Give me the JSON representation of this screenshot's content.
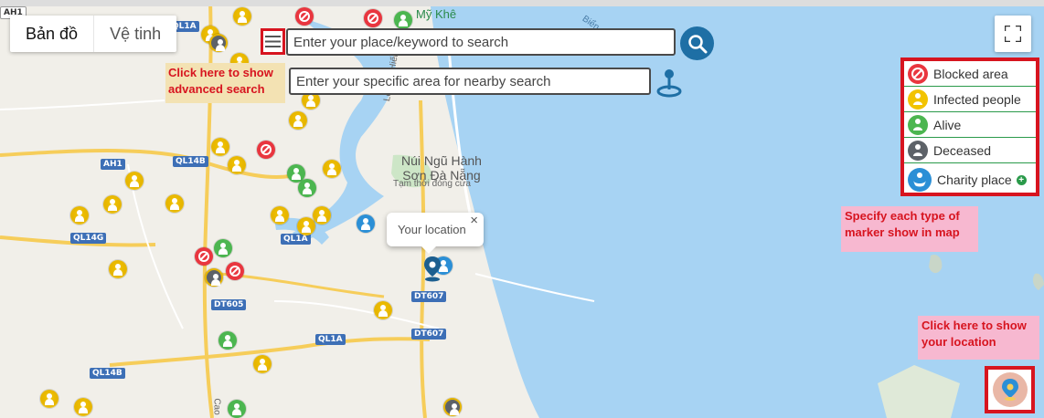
{
  "map_type": {
    "map_label": "Bản đồ",
    "satellite_label": "Vệ tinh"
  },
  "search": {
    "main_placeholder": "Enter your place/keyword to search",
    "nearby_placeholder": "Enter your specific area for nearby search"
  },
  "notes": {
    "advanced": "Click here to show advanced search",
    "legend": "Specify each type of marker show in map",
    "location": "Click here to show your location"
  },
  "legend": {
    "items": [
      {
        "label": "Blocked area",
        "icon": "blocked-icon"
      },
      {
        "label": "Infected people",
        "icon": "infected-person-icon"
      },
      {
        "label": "Alive",
        "icon": "alive-person-icon"
      },
      {
        "label": "Deceased",
        "icon": "deceased-person-icon"
      },
      {
        "label": "Charity place",
        "icon": "charity-icon"
      }
    ],
    "plus": "+"
  },
  "popup": {
    "text": "Your location",
    "close": "×"
  },
  "map_labels": {
    "my_khe": "Mỹ Khê",
    "ngu_hanh_son": "Núi Ngũ Hành\nSơn Đà Nẵng",
    "temp_closed": "Tạm thời đóng cửa",
    "le_van_hien": "Lê Văn Hiến",
    "bien": "Biển",
    "cao": "Cao"
  },
  "road_labels": [
    "QL1A",
    "QL14B",
    "AH1",
    "QL14G",
    "QL1A",
    "DT605",
    "DT607",
    "DT607",
    "QL1A",
    "QL14B",
    "AH1"
  ],
  "colors": {
    "sea": "#a7d3f3",
    "land": "#f1efe9",
    "annotation_red": "#d7141f",
    "blocked": "#e9363f",
    "infected": "#e5b400",
    "alive": "#4cb650",
    "deceased": "#5d6268",
    "charity": "#2b8fd6"
  }
}
